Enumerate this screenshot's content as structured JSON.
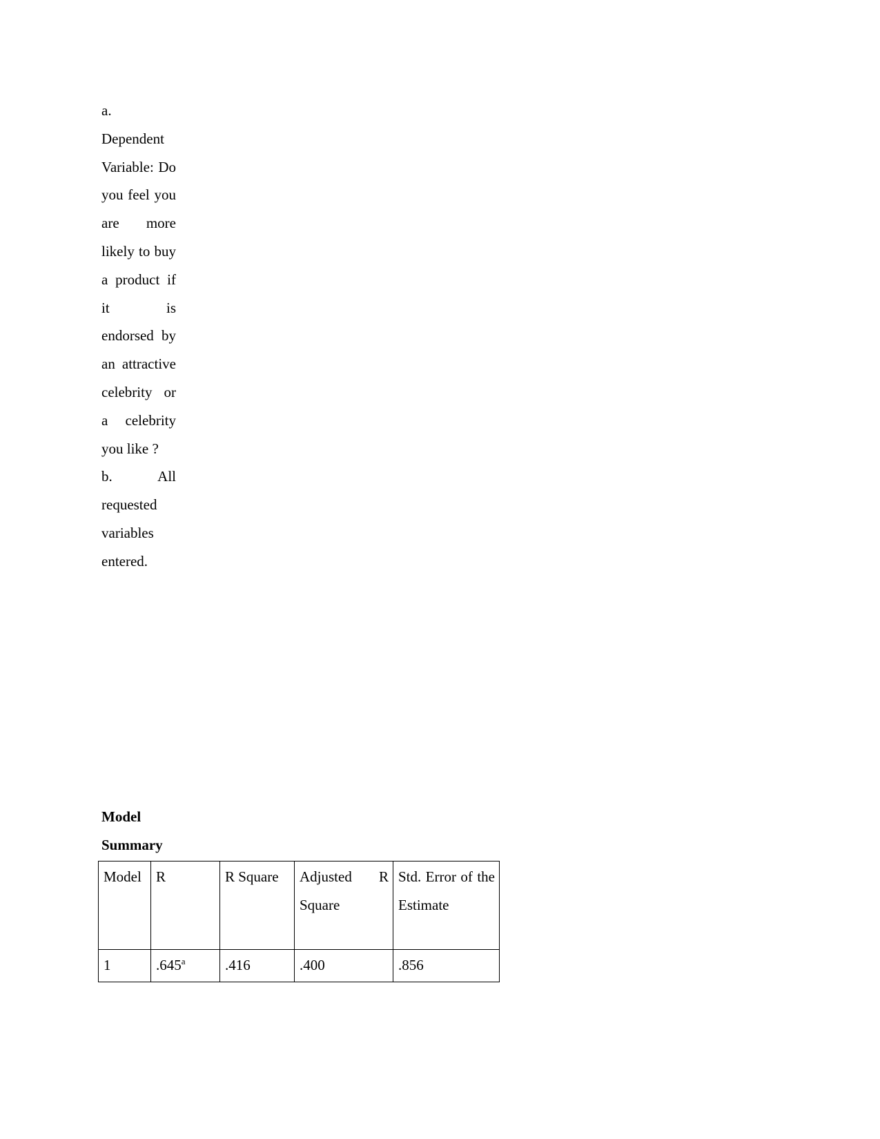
{
  "document": {
    "footnotes": {
      "note_a": "a. Dependent Variable: Do you feel you are more likely to buy a product if it is endorsed by an attractive celebrity or a celebrity you like ?",
      "note_b": "b. All requested variables entered."
    },
    "model_summary": {
      "heading": "Model Summary",
      "columns": [
        "Model",
        "R",
        "R Square",
        "Adjusted R Square",
        "Std. Error of the Estimate"
      ],
      "rows": [
        {
          "model": "1",
          "r": ".645",
          "r_superscript": "a",
          "r_square": ".416",
          "adjusted_r_square": ".400",
          "std_error_of_the_estimate": ".856"
        }
      ]
    }
  }
}
